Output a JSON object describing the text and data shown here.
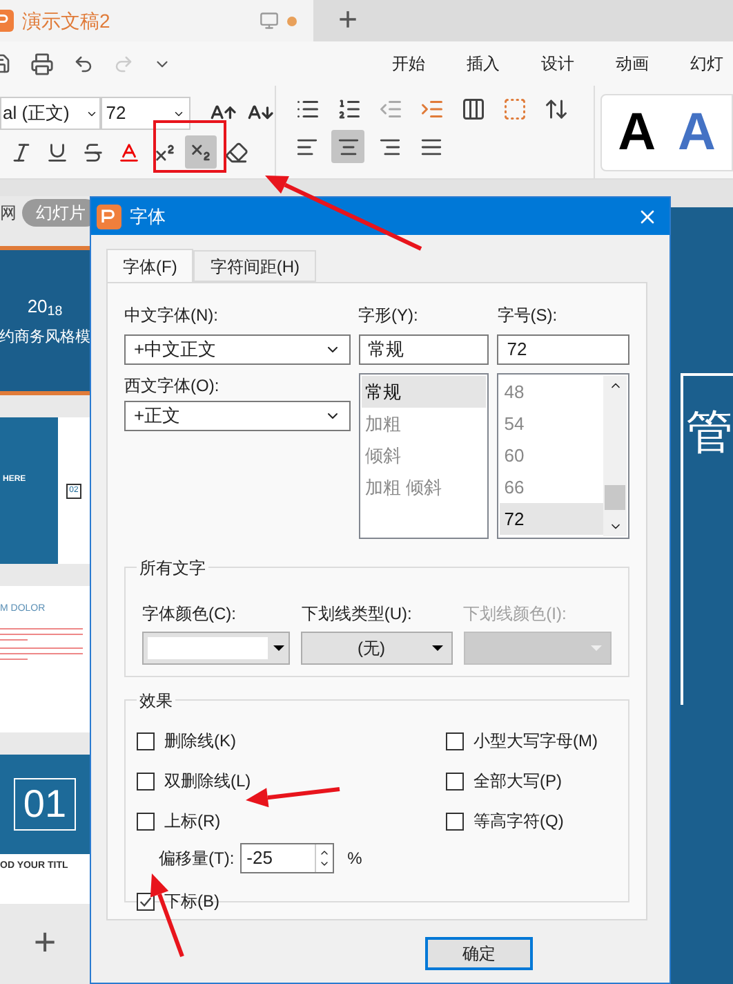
{
  "document_tab": {
    "title": "演示文稿2",
    "unsaved": true
  },
  "new_tab": "+",
  "menu_tabs": [
    "开始",
    "插入",
    "设计",
    "动画",
    "幻灯"
  ],
  "ribbon": {
    "font_name": "al (正文)",
    "font_size": "72",
    "format_buttons": [
      {
        "kind": "italic",
        "on": false
      },
      {
        "kind": "underline",
        "on": false
      },
      {
        "kind": "strike",
        "on": false
      },
      {
        "kind": "color",
        "on": false
      },
      {
        "kind": "superscript",
        "on": false
      },
      {
        "kind": "subscript",
        "on": true
      },
      {
        "kind": "clear",
        "on": false
      }
    ],
    "align_buttons": [
      {
        "kind": "left",
        "selected": false
      },
      {
        "kind": "center",
        "selected": true
      },
      {
        "kind": "right",
        "selected": false
      },
      {
        "kind": "justify",
        "selected": false
      }
    ],
    "style_samples": [
      {
        "text": "A",
        "color": "#000000"
      },
      {
        "text": "A",
        "color": "#4472c4"
      }
    ]
  },
  "slide_panel": {
    "tab": "网",
    "view_pill": "幻灯片",
    "slides": [
      {
        "kind": "cover",
        "year": "20$_{18}$",
        "title": "约商务风格模"
      },
      {
        "kind": "section",
        "heading": "HERE",
        "number": "02"
      },
      {
        "kind": "text",
        "heading": "M DOLOR"
      },
      {
        "kind": "chapter",
        "number": "01",
        "caption": "OD YOUR TITL"
      }
    ],
    "add_button": "+"
  },
  "canvas": {
    "slide_text": "管"
  },
  "dialog": {
    "title": "字体",
    "tabs": [
      {
        "label": "字体(F)",
        "selected": true
      },
      {
        "label": "字符间距(H)",
        "selected": false
      }
    ],
    "chinese_font": {
      "label": "中文字体(N):",
      "value": "+中文正文"
    },
    "western_font": {
      "label": "西文字体(O):",
      "value": "+正文"
    },
    "style": {
      "label": "字形(Y):",
      "value": "常规",
      "options": [
        {
          "label": "常规",
          "selected": true
        },
        {
          "label": "加粗",
          "selected": false
        },
        {
          "label": "倾斜",
          "selected": false
        },
        {
          "label": "加粗 倾斜",
          "selected": false
        }
      ]
    },
    "size": {
      "label": "字号(S):",
      "value": "72",
      "options": [
        {
          "label": "48",
          "selected": false
        },
        {
          "label": "54",
          "selected": false
        },
        {
          "label": "60",
          "selected": false
        },
        {
          "label": "66",
          "selected": false
        },
        {
          "label": "72",
          "selected": true
        }
      ]
    },
    "all_text": {
      "title": "所有文字",
      "font_color": {
        "label": "字体颜色(C):",
        "color": "#ffffff"
      },
      "underline_type": {
        "label": "下划线类型(U):",
        "value": "(无)"
      },
      "underline_color": {
        "label": "下划线颜色(I):",
        "disabled": true
      }
    },
    "effects": {
      "title": "效果",
      "left": [
        {
          "label": "删除线(K)",
          "checked": false
        },
        {
          "label": "双删除线(L)",
          "checked": false
        },
        {
          "label": "上标(R)",
          "checked": false
        }
      ],
      "offset": {
        "label": "偏移量(T):",
        "value": "-25",
        "unit": "%"
      },
      "subscript": {
        "label": "下标(B)",
        "checked": true
      },
      "right": [
        {
          "label": "小型大写字母(M)",
          "checked": false
        },
        {
          "label": "全部大写(P)",
          "checked": false
        },
        {
          "label": "等高字符(Q)",
          "checked": false
        }
      ]
    },
    "ok_button": "确定"
  }
}
